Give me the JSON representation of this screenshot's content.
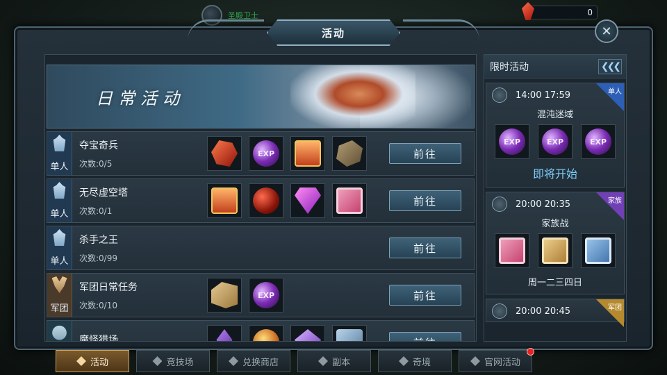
{
  "header": {
    "player_name": "圣殿卫士",
    "currency_value": "0",
    "title": "活动"
  },
  "banner": {
    "title": "日常活动"
  },
  "activities": [
    {
      "type": "单人",
      "name": "夺宝奇兵",
      "count": "次数:0/5",
      "rewards": [
        "red-crystal-icon",
        "exp-orb-icon",
        "exp-chest-icon",
        "stone-icon"
      ],
      "button": "前往"
    },
    {
      "type": "单人",
      "name": "无尽虚空塔",
      "count": "次数:0/1",
      "rewards": [
        "exp-chest-icon",
        "red-orb-icon",
        "diamond-icon",
        "gift-box-icon"
      ],
      "button": "前往"
    },
    {
      "type": "单人",
      "name": "杀手之王",
      "count": "次数:0/99",
      "rewards": [],
      "button": "前往"
    },
    {
      "type": "军团",
      "name": "军团日常任务",
      "count": "次数:0/10",
      "rewards": [
        "boxes-icon",
        "exp-orb-icon"
      ],
      "button": "前往"
    },
    {
      "type": "",
      "name": "魔怪猎场",
      "count": "",
      "rewards": [
        "purple-crystal-icon",
        "amber-icon",
        "violet-gem-icon",
        "blue-gift-icon"
      ],
      "button": "前往"
    }
  ],
  "side": {
    "header": "限时活动",
    "collapse_label": "❮❮❮",
    "cards": [
      {
        "time": "14:00  17:59",
        "tag": "单人",
        "title": "混沌迷域",
        "status": "即将开始"
      },
      {
        "time": "20:00  20:35",
        "tag": "家族",
        "title": "家族战",
        "days": "周一二三四日"
      },
      {
        "time": "20:00  20:45",
        "tag": "军团"
      }
    ]
  },
  "tabs": [
    {
      "label": "活动",
      "active": true
    },
    {
      "label": "竞技场",
      "active": false
    },
    {
      "label": "兑换商店",
      "active": false
    },
    {
      "label": "副本",
      "active": false
    },
    {
      "label": "奇境",
      "active": false
    },
    {
      "label": "官网活动",
      "active": false
    }
  ],
  "colors": {
    "accent_blue": "#7fd0ff",
    "active_tab": "#7a5a2e",
    "notification": "#e62222"
  }
}
